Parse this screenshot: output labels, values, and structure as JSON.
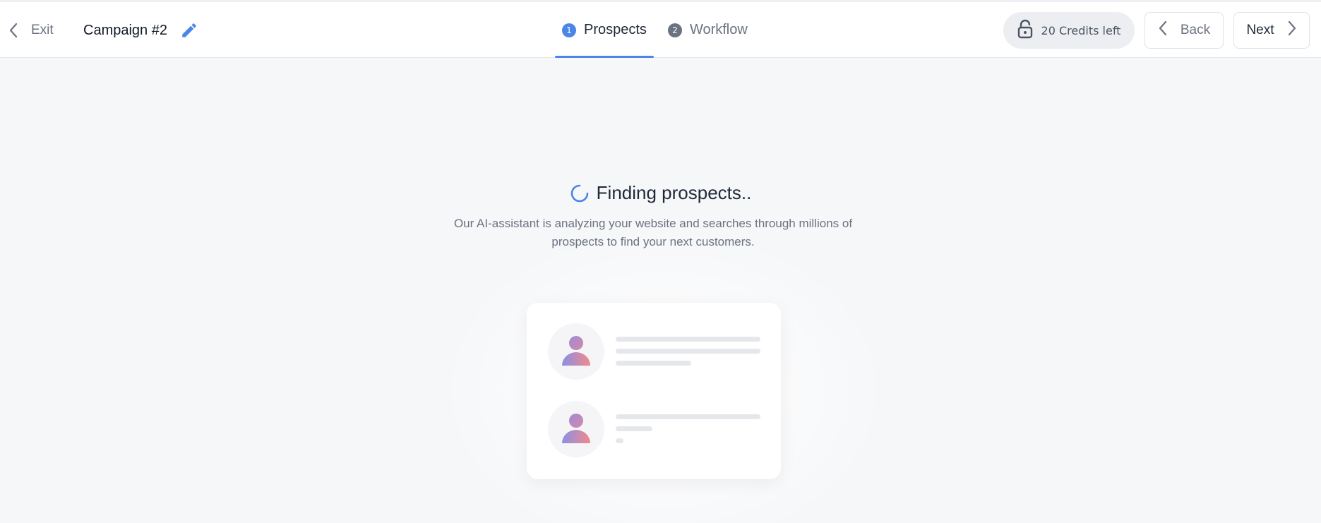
{
  "header": {
    "exit_label": "Exit",
    "campaign_name": "Campaign #2",
    "steps": [
      {
        "number": "1",
        "label": "Prospects",
        "active": true
      },
      {
        "number": "2",
        "label": "Workflow",
        "active": false
      }
    ],
    "credits_label": "20 Credits left",
    "back_label": "Back",
    "next_label": "Next"
  },
  "main": {
    "title": "Finding prospects..",
    "description": "Our AI-assistant is analyzing your website and searches through millions of prospects to find your next customers."
  },
  "colors": {
    "accent": "#4a86e8",
    "background": "#f6f7f9",
    "avatar_gradient_start": "#8b8fe8",
    "avatar_gradient_end": "#f08a8a"
  },
  "icons": {
    "exit": "chevron-left-icon",
    "edit": "pencil-icon",
    "credits": "lock-icon",
    "back": "chevron-left-icon",
    "next": "chevron-right-icon",
    "loading": "spinner-icon",
    "avatar": "user-icon"
  }
}
